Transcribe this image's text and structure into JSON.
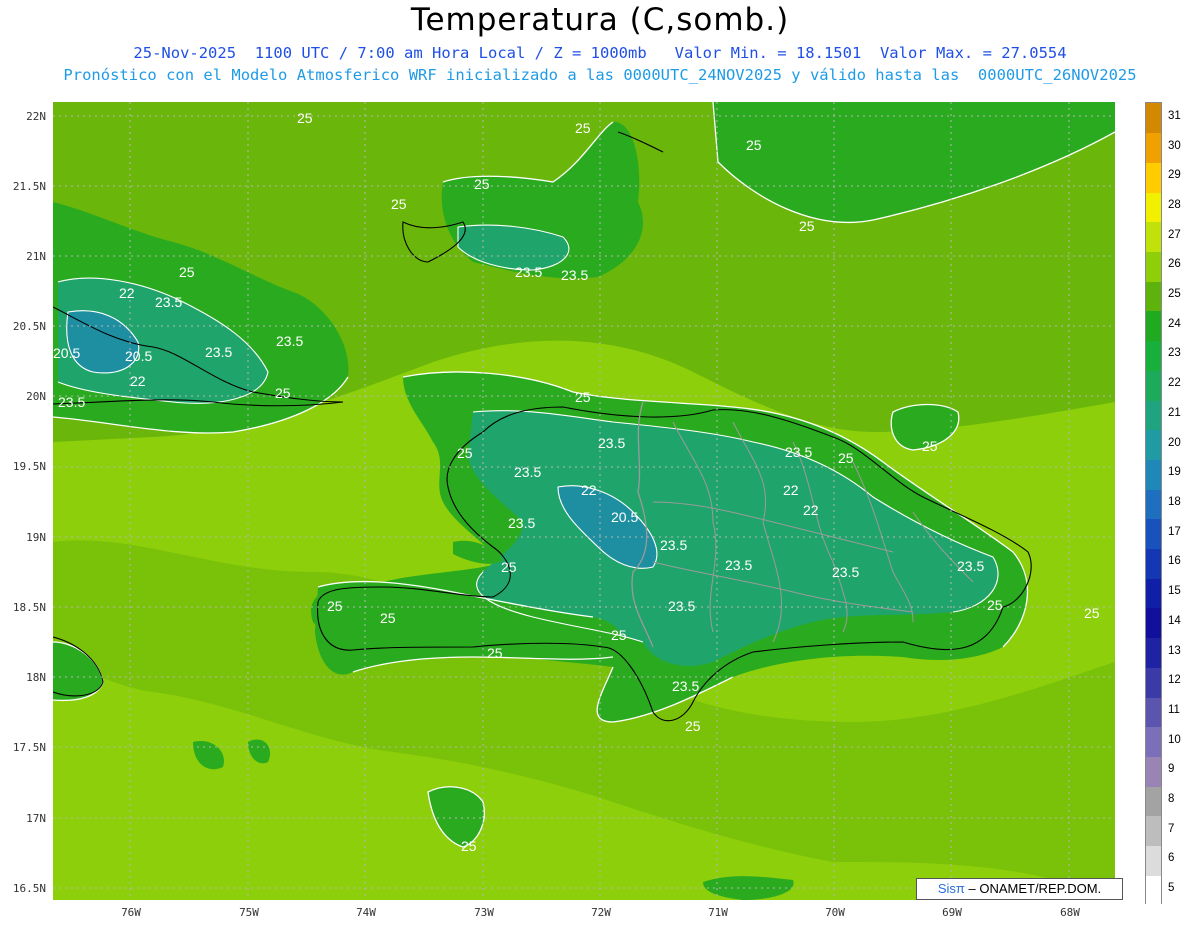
{
  "header": {
    "title": "Temperatura (C,somb.)",
    "line1": "25-Nov-2025  1100 UTC / 7:00 am Hora Local / Z = 1000mb   Valor Min. = 18.1501  Valor Max. = 27.0554",
    "line2": "Pronóstico con el Modelo Atmosferico WRF inicializado a las 0000UTC_24NOV2025 y válido hasta las  0000UTC_26NOV2025"
  },
  "axes": {
    "lat_labels": [
      "22N",
      "21.5N",
      "21N",
      "20.5N",
      "20N",
      "19.5N",
      "19N",
      "18.5N",
      "18N",
      "17.5N",
      "17N",
      "16.5N"
    ],
    "lon_labels": [
      "76W",
      "75W",
      "74W",
      "73W",
      "72W",
      "71W",
      "70W",
      "69W",
      "68W"
    ]
  },
  "colorbar": {
    "levels": [
      "5",
      "6",
      "7",
      "8",
      "9",
      "10",
      "11",
      "12",
      "13",
      "14",
      "15",
      "16",
      "17",
      "18",
      "19",
      "20",
      "21",
      "22",
      "23",
      "24",
      "25",
      "26",
      "27",
      "28",
      "29",
      "30",
      "31"
    ],
    "colors": [
      "#ffffff",
      "#dcdcdc",
      "#bdbdbd",
      "#a3a3a3",
      "#9a83b5",
      "#7a6fb8",
      "#5b55b0",
      "#3a3aa8",
      "#1f22a3",
      "#10109c",
      "#0f1fa8",
      "#1437b4",
      "#1a52bd",
      "#1e6fbf",
      "#2088b8",
      "#209aa3",
      "#1ea47f",
      "#1cab5a",
      "#17b03b",
      "#1faa1f",
      "#5db30c",
      "#8ecf0a",
      "#c0e20a",
      "#f0f000",
      "#ffcc00",
      "#f0a000",
      "#d48700"
    ]
  },
  "contour_labels": [
    "25",
    "23.5",
    "22",
    "20.5"
  ],
  "credit": {
    "sis": "Sisπ",
    "rest": "– ONAMET/REP.DOM."
  }
}
